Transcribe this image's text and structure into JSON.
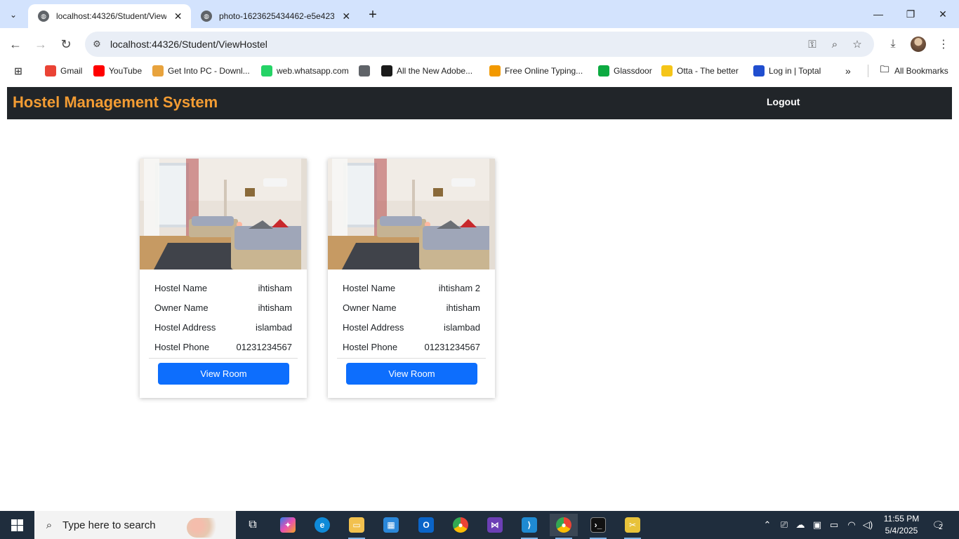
{
  "browser": {
    "tabs": [
      {
        "title": "localhost:44326/Student/ViewH",
        "active": true
      },
      {
        "title": "photo-1623625434462-e5e423",
        "active": false
      }
    ],
    "url": "localhost:44326/Student/ViewHostel",
    "bookmarks": [
      {
        "label": "Gmail",
        "icon": "gmail-icon",
        "color": "#ea4335"
      },
      {
        "label": "YouTube",
        "icon": "youtube-icon",
        "color": "#ff0000"
      },
      {
        "label": "Get Into PC - Downl...",
        "icon": "getintopc-icon",
        "color": "#e8a33d"
      },
      {
        "label": "web.whatsapp.com",
        "icon": "whatsapp-icon",
        "color": "#25d366"
      },
      {
        "label": "",
        "icon": "globe-icon",
        "color": "#5f6368"
      },
      {
        "label": "All the New Adobe...",
        "icon": "adobe-icon",
        "color": "#1a1a1a"
      },
      {
        "label": "Free Online Typing...",
        "icon": "typing-icon",
        "color": "#f29900"
      },
      {
        "label": "Glassdoor",
        "icon": "glassdoor-icon",
        "color": "#0caa41"
      },
      {
        "label": "Otta - The better",
        "icon": "otta-icon",
        "color": "#f5c518"
      },
      {
        "label": "Log in | Toptal",
        "icon": "toptal-icon",
        "color": "#204ecf"
      }
    ],
    "all_bookmarks_label": "All Bookmarks",
    "overflow_label": "»"
  },
  "app": {
    "brand": "Hostel Management System",
    "logout_label": "Logout",
    "accent": "#f39c33",
    "navbar_color": "#212529",
    "button_color": "#0d6efd"
  },
  "hostels": [
    {
      "rows": [
        {
          "label": "Hostel Name",
          "value": "ihtisham"
        },
        {
          "label": "Owner Name",
          "value": "ihtisham"
        },
        {
          "label": "Hostel Address",
          "value": "islambad"
        },
        {
          "label": "Hostel Phone",
          "value": "01231234567"
        }
      ],
      "button_label": "View Room"
    },
    {
      "rows": [
        {
          "label": "Hostel Name",
          "value": "ihtisham 2"
        },
        {
          "label": "Owner Name",
          "value": "ihtisham"
        },
        {
          "label": "Hostel Address",
          "value": "islambad"
        },
        {
          "label": "Hostel Phone",
          "value": "01231234567"
        }
      ],
      "button_label": "View Room"
    }
  ],
  "taskbar": {
    "search_placeholder": "Type here to search",
    "time": "11:55 PM",
    "date": "5/4/2025",
    "notification_count": "2"
  }
}
